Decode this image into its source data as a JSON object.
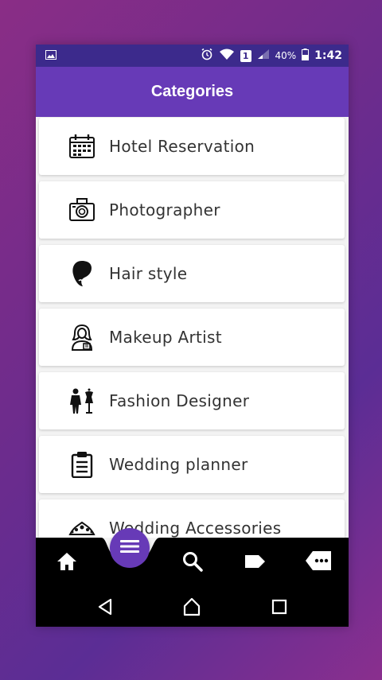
{
  "status_bar": {
    "battery_percent": "40%",
    "time": "1:42",
    "sim_badge": "1"
  },
  "app_bar": {
    "title": "Categories"
  },
  "categories": [
    {
      "label": "Hotel Reservation",
      "icon": "calendar-icon"
    },
    {
      "label": "Photographer",
      "icon": "camera-icon"
    },
    {
      "label": "Hair style",
      "icon": "hair-icon"
    },
    {
      "label": "Makeup Artist",
      "icon": "makeup-artist-icon"
    },
    {
      "label": "Fashion Designer",
      "icon": "mannequin-icon"
    },
    {
      "label": "Wedding planner",
      "icon": "clipboard-icon"
    },
    {
      "label": "Wedding Accessories",
      "icon": "tiara-icon"
    }
  ],
  "bottom_nav": [
    "home-icon",
    "menu-icon",
    "search-icon",
    "tag-icon",
    "more-icon"
  ],
  "system_nav": [
    "back-icon",
    "home-outline-icon",
    "recents-icon"
  ],
  "colors": {
    "primary": "#673ab7",
    "status": "#3c2a8c"
  }
}
